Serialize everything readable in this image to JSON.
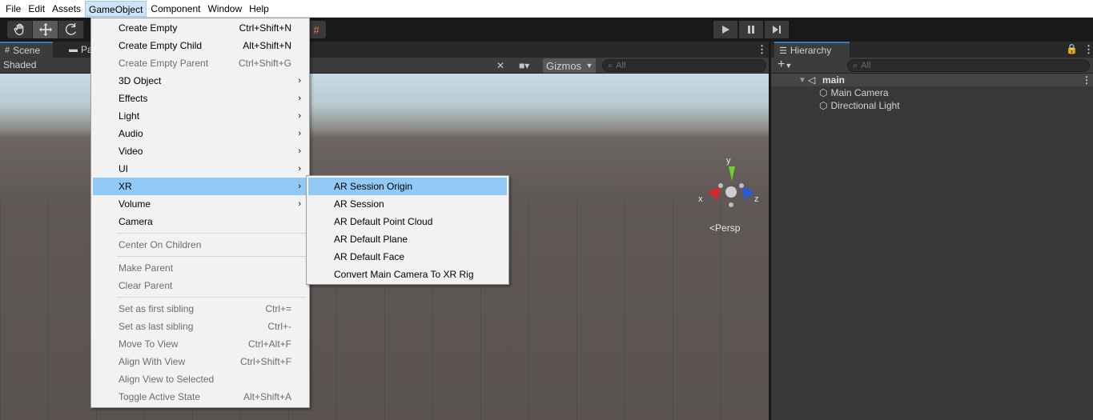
{
  "menubar": {
    "items": [
      "File",
      "Edit",
      "Assets",
      "GameObject",
      "Component",
      "Window",
      "Help"
    ],
    "active_index": 3
  },
  "toolbar": {
    "tools": [
      "hand-icon",
      "move-icon",
      "rotate-icon"
    ],
    "selected_tool": "move-icon"
  },
  "scene_panel": {
    "tabs": [
      {
        "label": "Scene",
        "icon": "hash-icon"
      },
      {
        "label": "Pa",
        "icon": "folder-icon"
      }
    ],
    "shading_mode": "Shaded",
    "gizmos_label": "Gizmos",
    "search_placeholder": "All",
    "persp_label": "Persp",
    "axis_labels": {
      "x": "x",
      "y": "y",
      "z": "z"
    }
  },
  "hierarchy": {
    "tab_label": "Hierarchy",
    "add_label": "+",
    "search_placeholder": "All",
    "scene_name": "main",
    "objects": [
      "Main Camera",
      "Directional Light"
    ]
  },
  "gameobject_menu": {
    "items": [
      {
        "label": "Create Empty",
        "shortcut": "Ctrl+Shift+N",
        "enabled": true
      },
      {
        "label": "Create Empty Child",
        "shortcut": "Alt+Shift+N",
        "enabled": true
      },
      {
        "label": "Create Empty Parent",
        "shortcut": "Ctrl+Shift+G",
        "enabled": false
      },
      {
        "label": "3D Object",
        "submenu": true,
        "enabled": true
      },
      {
        "label": "Effects",
        "submenu": true,
        "enabled": true
      },
      {
        "label": "Light",
        "submenu": true,
        "enabled": true
      },
      {
        "label": "Audio",
        "submenu": true,
        "enabled": true
      },
      {
        "label": "Video",
        "submenu": true,
        "enabled": true
      },
      {
        "label": "UI",
        "submenu": true,
        "enabled": true
      },
      {
        "label": "XR",
        "submenu": true,
        "enabled": true,
        "highlighted": true
      },
      {
        "label": "Volume",
        "submenu": true,
        "enabled": true
      },
      {
        "label": "Camera",
        "enabled": true
      },
      {
        "label": "Center On Children",
        "enabled": false
      },
      {
        "label": "Make Parent",
        "enabled": false
      },
      {
        "label": "Clear Parent",
        "enabled": false
      },
      {
        "label": "Set as first sibling",
        "shortcut": "Ctrl+=",
        "enabled": false
      },
      {
        "label": "Set as last sibling",
        "shortcut": "Ctrl+-",
        "enabled": false
      },
      {
        "label": "Move To View",
        "shortcut": "Ctrl+Alt+F",
        "enabled": false
      },
      {
        "label": "Align With View",
        "shortcut": "Ctrl+Shift+F",
        "enabled": false
      },
      {
        "label": "Align View to Selected",
        "enabled": false
      },
      {
        "label": "Toggle Active State",
        "shortcut": "Alt+Shift+A",
        "enabled": false
      }
    ]
  },
  "xr_submenu": {
    "items": [
      {
        "label": "AR Session Origin",
        "highlighted": true
      },
      {
        "label": "AR Session"
      },
      {
        "label": "AR Default Point Cloud"
      },
      {
        "label": "AR Default Plane"
      },
      {
        "label": "AR Default Face"
      },
      {
        "label": "Convert Main Camera To XR Rig"
      }
    ]
  },
  "colors": {
    "menu_highlight": "#91c9f7",
    "menubar_active": "#cce4f7",
    "axis_x": "#d02a2a",
    "axis_y": "#6cd12e",
    "axis_z": "#2a5bd7"
  }
}
